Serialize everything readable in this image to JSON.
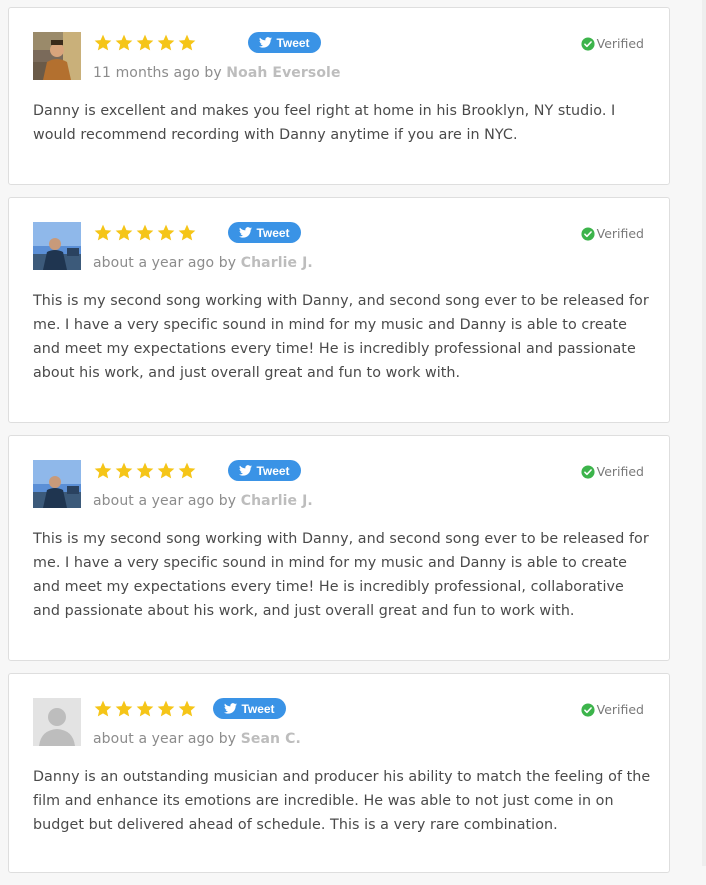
{
  "colors": {
    "star": "#f5c518",
    "tweet_bg": "#3a93e6",
    "verified_check": "#3cb44b",
    "author": "#bdbdbd",
    "meta": "#8c8c8c"
  },
  "reviews": [
    {
      "rating": 5,
      "tweet_label": "Tweet",
      "time": "11 months ago",
      "by": "by",
      "author": "Noah Eversole",
      "verified_label": "Verified",
      "body": "Danny is excellent and makes you feel right at home in his Brooklyn, NY studio. I would recommend recording with Danny anytime if you are in NYC.",
      "avatar": "photo-avatar-icon"
    },
    {
      "rating": 5,
      "tweet_label": "Tweet",
      "time": "about a year ago",
      "by": "by",
      "author": "Charlie J.",
      "verified_label": "Verified",
      "body": "This is my second song working with Danny, and second song ever to be released for me. I have a very specific sound in mind for my music and Danny is able to create and meet my expectations every time! He is incredibly professional and passionate about his work, and just overall great and fun to work with.",
      "avatar": "photo-avatar-icon"
    },
    {
      "rating": 5,
      "tweet_label": "Tweet",
      "time": "about a year ago",
      "by": "by",
      "author": "Charlie J.",
      "verified_label": "Verified",
      "body": "This is my second song working with Danny, and second song ever to be released for me. I have a very specific sound in mind for my music and Danny is able to create and meet my expectations every time! He is incredibly professional, collaborative and passionate about his work, and just overall great and fun to work with.",
      "avatar": "photo-avatar-icon"
    },
    {
      "rating": 5,
      "tweet_label": "Tweet",
      "time": "about a year ago",
      "by": "by",
      "author": "Sean C.",
      "verified_label": "Verified",
      "body": "Danny is an outstanding musician and producer his ability to match the feeling of the film and enhance its emotions are incredible. He was able to not just come in on budget but delivered ahead of schedule. This is a very rare combination.",
      "avatar": "default-avatar-icon"
    }
  ]
}
